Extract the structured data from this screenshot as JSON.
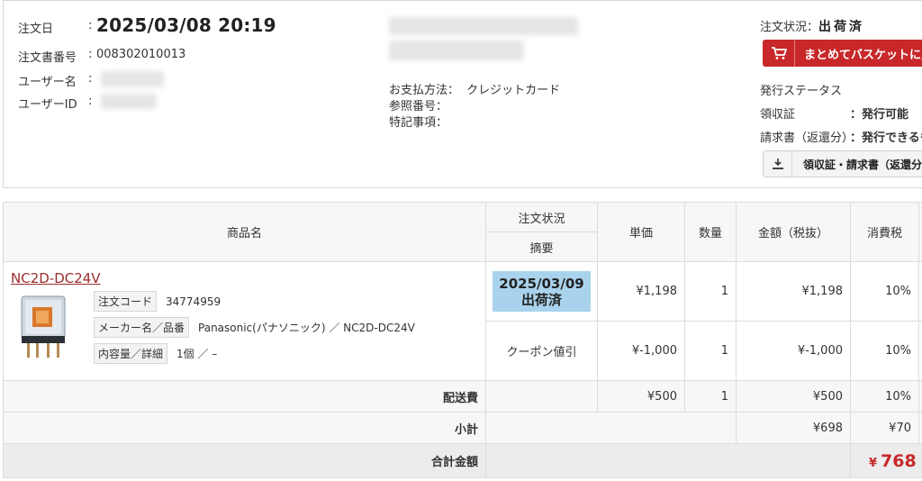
{
  "order": {
    "date_label": "注文日",
    "date_value": "2025/03/08 20:19",
    "number_label": "注文書番号",
    "number_value": "008302010013",
    "user_name_label": "ユーザー名",
    "user_id_label": "ユーザーID",
    "colon": ":"
  },
  "payment": {
    "method_label": "お支払方法：",
    "method_value": "クレジットカード",
    "ref_label": "参照番号：",
    "note_label": "特記事項："
  },
  "status_panel": {
    "status_label": "注文状況：",
    "status_value": "出荷済",
    "basket_button": "まとめてバスケットに入",
    "issue_status_label": "発行ステータス",
    "receipt_label": "領収証",
    "receipt_value": "：発行可能",
    "invoice_label": "請求書（返還分）",
    "invoice_value": "：発行できるも",
    "download_button": "領収証・請求書（返還分"
  },
  "table": {
    "headers": {
      "product": "商品名",
      "status": "注文状況",
      "summary": "摘要",
      "unit_price": "単価",
      "qty": "数量",
      "amount": "金額（税抜）",
      "tax": "消費税"
    },
    "item": {
      "name": "NC2D-DC24V",
      "code_tag": "注文コード",
      "code_value": "34774959",
      "maker_tag": "メーカー名／品番",
      "maker_value": "Panasonic(パナソニック) ／ NC2D-DC24V",
      "content_tag": "内容量／詳細",
      "content_value": "1個 ／ –",
      "status_date": "2025/03/09",
      "status_text": "出荷済",
      "unit_price": "¥1,198",
      "qty": "1",
      "amount": "¥1,198",
      "tax": "10%"
    },
    "coupon": {
      "summary": "クーポン値引",
      "unit_price": "¥-1,000",
      "qty": "1",
      "amount": "¥-1,000",
      "tax": "10%"
    },
    "shipping": {
      "label": "配送費",
      "unit_price": "¥500",
      "qty": "1",
      "amount": "¥500",
      "tax": "10%"
    },
    "subtotal": {
      "label": "小計",
      "amount": "¥698",
      "tax": "¥70"
    },
    "total": {
      "label": "合計金額",
      "yen": "¥",
      "amount": "768"
    }
  },
  "icons": {
    "basket": "cart-icon",
    "download": "download-icon",
    "product": "relay-product-image"
  },
  "colors": {
    "accent_red": "#c8282a",
    "status_badge": "#a9d3ec",
    "link": "#9b2d2d"
  }
}
